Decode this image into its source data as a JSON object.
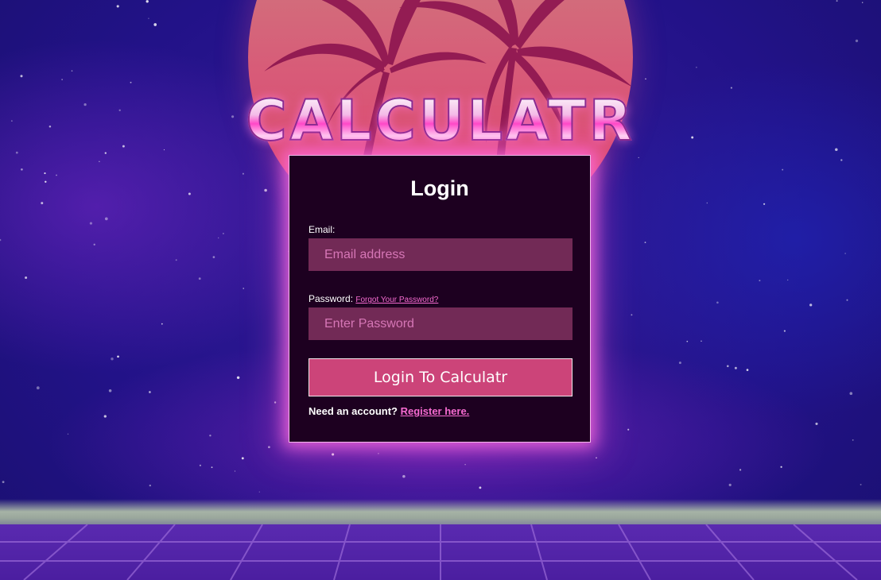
{
  "brand": {
    "logo_text": "CALCULATR"
  },
  "login": {
    "title": "Login",
    "email_label": "Email:",
    "email_placeholder": "Email address",
    "email_value": "",
    "password_label": "Password:",
    "forgot_link": "Forgot Your Password?",
    "password_placeholder": "Enter Password",
    "password_value": "",
    "submit_label": "Login To Calculatr",
    "register_prompt": "Need an account?",
    "register_link": "Register here."
  },
  "colors": {
    "accent": "#cc4479",
    "link": "#f56bd0",
    "card_bg": "#1d0020",
    "input_bg": "#722a56",
    "glow": "#ff6ee1"
  }
}
